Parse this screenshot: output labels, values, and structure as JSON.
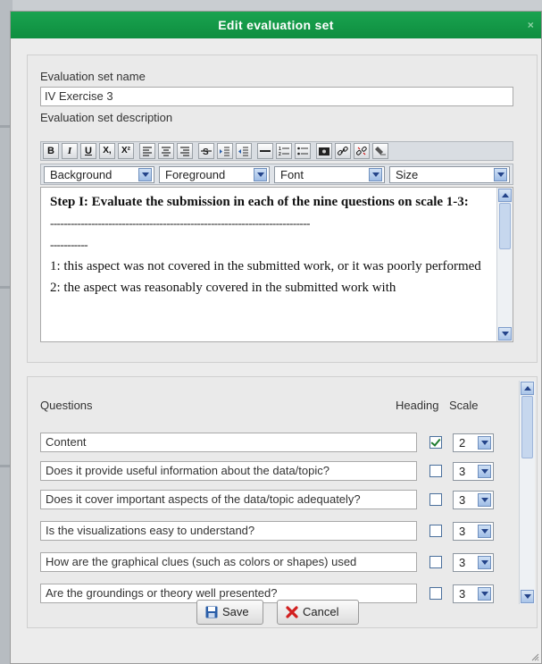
{
  "dialog": {
    "title": "Edit evaluation set",
    "close_glyph": "×"
  },
  "form": {
    "name_label": "Evaluation set name",
    "name_value": "IV Exercise 3",
    "description_label": "Evaluation set description"
  },
  "toolbar": {
    "buttons": [
      "B",
      "I",
      "U",
      "X,",
      "X²"
    ]
  },
  "selects": {
    "background": "Background",
    "foreground": "Foreground",
    "font": "Font",
    "size": "Size"
  },
  "editor": {
    "heading": "Step I: Evaluate the submission in each of the nine questions on scale 1-3:",
    "divider": "----------------------------------------------------------------------------",
    "divider2": "-----------",
    "line1": "1: this aspect was not covered in the submitted work, or it was poorly performed",
    "line2": "2: the aspect was reasonably covered in the submitted work with"
  },
  "questions": {
    "header_questions": "Questions",
    "header_heading": "Heading",
    "header_scale": "Scale",
    "rows": [
      {
        "text": "Content",
        "heading": true,
        "scale": "2"
      },
      {
        "text": "Does it provide useful information about the data/topic?",
        "heading": false,
        "scale": "3"
      },
      {
        "text": "Does it cover important aspects of the data/topic adequately?",
        "heading": false,
        "scale": "3"
      },
      {
        "text": "Is the visualizations easy to understand?",
        "heading": false,
        "scale": "3"
      },
      {
        "text": "How are the graphical clues (such as colors or shapes) used",
        "heading": false,
        "scale": "3"
      },
      {
        "text": "Are the groundings or theory well presented?",
        "heading": false,
        "scale": "3"
      }
    ]
  },
  "buttons": {
    "save": "Save",
    "cancel": "Cancel"
  },
  "colors": {
    "title_bar": "#0e8e3f",
    "checkbox_check": "#1e7c2e",
    "cancel_icon": "#d21f1f",
    "save_icon": "#2a5ea8"
  }
}
